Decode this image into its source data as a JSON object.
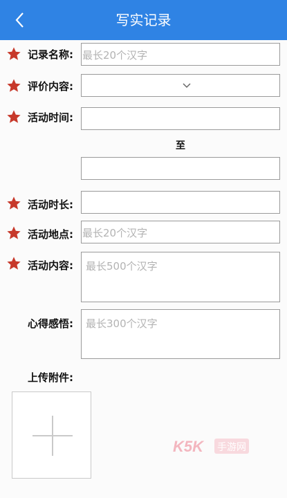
{
  "header": {
    "title": "写实记录",
    "back_icon": "chevron-left-icon"
  },
  "form": {
    "record_name": {
      "label": "记录名称:",
      "placeholder": "最长20个汉字",
      "required": true
    },
    "evaluation_content": {
      "label": "评价内容:",
      "value": "",
      "required": true
    },
    "activity_time": {
      "label": "活动时间:",
      "start_value": "",
      "separator": "至",
      "end_value": "",
      "required": true
    },
    "activity_duration": {
      "label": "活动时长:",
      "value": "",
      "required": true
    },
    "activity_location": {
      "label": "活动地点:",
      "placeholder": "最长20个汉字",
      "required": true
    },
    "activity_content": {
      "label": "活动内容:",
      "placeholder": "最长500个汉字",
      "required": true
    },
    "reflection": {
      "label": "心得感悟:",
      "placeholder": "最长300个汉字",
      "required": false
    },
    "attachment": {
      "label": "上传附件:"
    }
  },
  "watermark": {
    "text_left": "K5K",
    "text_right": "手游网"
  },
  "colors": {
    "header_bg": "#2f83e4",
    "star": "#c7392b",
    "border": "#9a9a9a",
    "placeholder": "#b3b3b3"
  }
}
